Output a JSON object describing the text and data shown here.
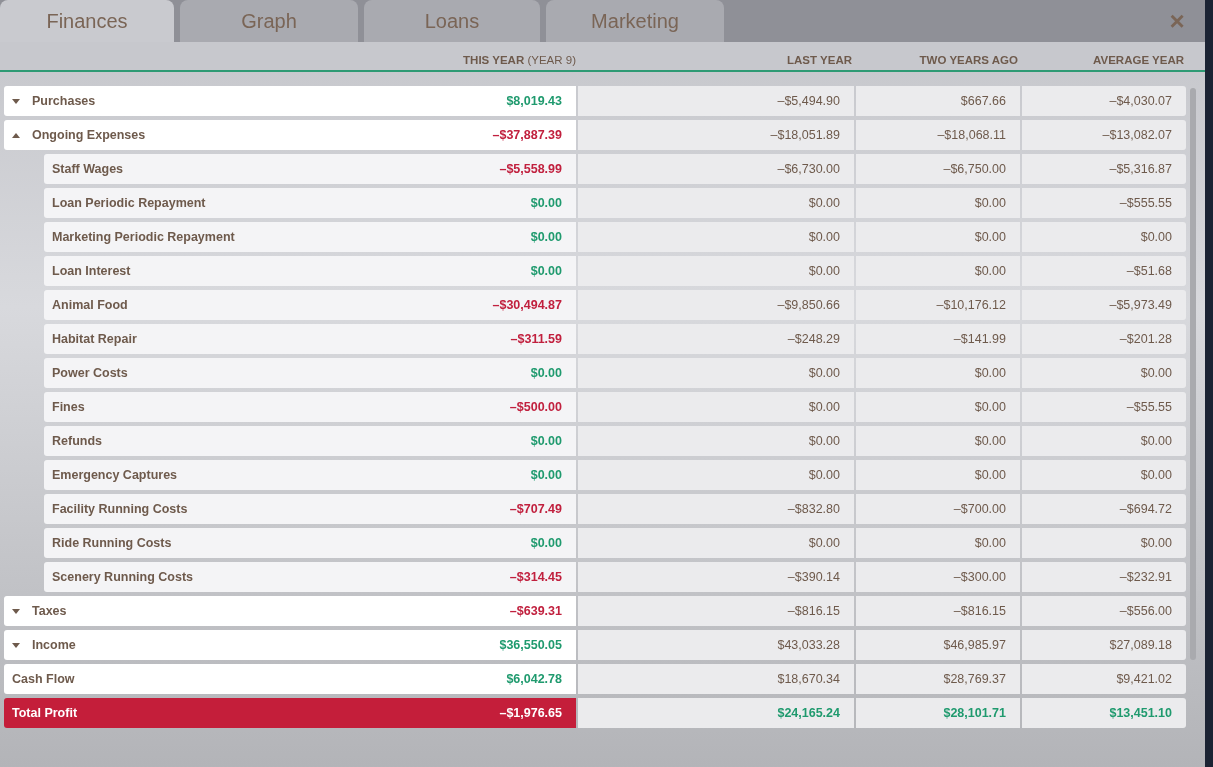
{
  "tabs": [
    {
      "label": "Finances",
      "selected": true
    },
    {
      "label": "Graph",
      "selected": false
    },
    {
      "label": "Loans",
      "selected": false
    },
    {
      "label": "Marketing",
      "selected": false
    }
  ],
  "close": "×",
  "table": {
    "columns": [
      "**THIS YEAR** (YEAR 9)",
      "LAST YEAR",
      "TWO YEARS AGO",
      "AVERAGE YEAR"
    ],
    "rows": [
      {
        "kind": "group",
        "label": "Purchases",
        "expanded": false,
        "this_year": "$8,019.43",
        "color": "#1f9a6e",
        "last_year": "–$5,494.90",
        "two_years_ago": "$667.66",
        "average_year": "–$4,030.07"
      },
      {
        "kind": "group",
        "label": "Ongoing Expenses",
        "expanded": true,
        "this_year": "–$37,887.39",
        "color": "#c1203e",
        "last_year": "–$18,051.89",
        "two_years_ago": "–$18,068.11",
        "average_year": "–$13,082.07",
        "children": [
          {
            "kind": "item",
            "label": "Staff Wages",
            "this_year": "–$5,558.99",
            "color": "#c1203e",
            "last_year": "–$6,730.00",
            "two_years_ago": "–$6,750.00",
            "average_year": "–$5,316.87"
          },
          {
            "kind": "item",
            "label": "Loan Periodic Repayment",
            "this_year": "$0.00",
            "color": "#1f9a6e",
            "last_year": "$0.00",
            "two_years_ago": "$0.00",
            "average_year": "–$555.55"
          },
          {
            "kind": "item",
            "label": "Marketing Periodic Repayment",
            "this_year": "$0.00",
            "color": "#1f9a6e",
            "last_year": "$0.00",
            "two_years_ago": "$0.00",
            "average_year": "$0.00"
          },
          {
            "kind": "item",
            "label": "Loan Interest",
            "this_year": "$0.00",
            "color": "#1f9a6e",
            "last_year": "$0.00",
            "two_years_ago": "$0.00",
            "average_year": "–$51.68"
          },
          {
            "kind": "item",
            "label": "Animal Food",
            "this_year": "–$30,494.87",
            "color": "#c1203e",
            "last_year": "–$9,850.66",
            "two_years_ago": "–$10,176.12",
            "average_year": "–$5,973.49"
          },
          {
            "kind": "item",
            "label": "Habitat Repair",
            "this_year": "–$311.59",
            "color": "#c1203e",
            "last_year": "–$248.29",
            "two_years_ago": "–$141.99",
            "average_year": "–$201.28"
          },
          {
            "kind": "item",
            "label": "Power Costs",
            "this_year": "$0.00",
            "color": "#1f9a6e",
            "last_year": "$0.00",
            "two_years_ago": "$0.00",
            "average_year": "$0.00"
          },
          {
            "kind": "item",
            "label": "Fines",
            "this_year": "–$500.00",
            "color": "#c1203e",
            "last_year": "$0.00",
            "two_years_ago": "$0.00",
            "average_year": "–$55.55"
          },
          {
            "kind": "item",
            "label": "Refunds",
            "this_year": "$0.00",
            "color": "#1f9a6e",
            "last_year": "$0.00",
            "two_years_ago": "$0.00",
            "average_year": "$0.00"
          },
          {
            "kind": "item",
            "label": "Emergency Captures",
            "this_year": "$0.00",
            "color": "#1f9a6e",
            "last_year": "$0.00",
            "two_years_ago": "$0.00",
            "average_year": "$0.00"
          },
          {
            "kind": "item",
            "label": "Facility Running Costs",
            "this_year": "–$707.49",
            "color": "#c1203e",
            "last_year": "–$832.80",
            "two_years_ago": "–$700.00",
            "average_year": "–$694.72"
          },
          {
            "kind": "item",
            "label": "Ride Running Costs",
            "this_year": "$0.00",
            "color": "#1f9a6e",
            "last_year": "$0.00",
            "two_years_ago": "$0.00",
            "average_year": "$0.00"
          },
          {
            "kind": "item",
            "label": "Scenery Running Costs",
            "this_year": "–$314.45",
            "color": "#c1203e",
            "last_year": "–$390.14",
            "two_years_ago": "–$300.00",
            "average_year": "–$232.91"
          }
        ]
      },
      {
        "kind": "group",
        "label": "Taxes",
        "expanded": false,
        "this_year": "–$639.31",
        "color": "#c1203e",
        "last_year": "–$816.15",
        "two_years_ago": "–$816.15",
        "average_year": "–$556.00"
      },
      {
        "kind": "group",
        "label": "Income",
        "expanded": false,
        "this_year": "$36,550.05",
        "color": "#1f9a6e",
        "last_year": "$43,033.28",
        "two_years_ago": "$46,985.97",
        "average_year": "$27,089.18"
      },
      {
        "kind": "summary",
        "label": "Cash Flow",
        "this_year": "$6,042.78",
        "color": "#1f9a6e",
        "last_year": "$18,670.34",
        "two_years_ago": "$28,769.37",
        "average_year": "$9,421.02"
      },
      {
        "kind": "total",
        "label": "Total Profit",
        "this_year": "–$1,976.65",
        "last_year": "$24,165.24",
        "two_years_ago": "$28,101.71",
        "average_year": "$13,451.10"
      }
    ]
  }
}
